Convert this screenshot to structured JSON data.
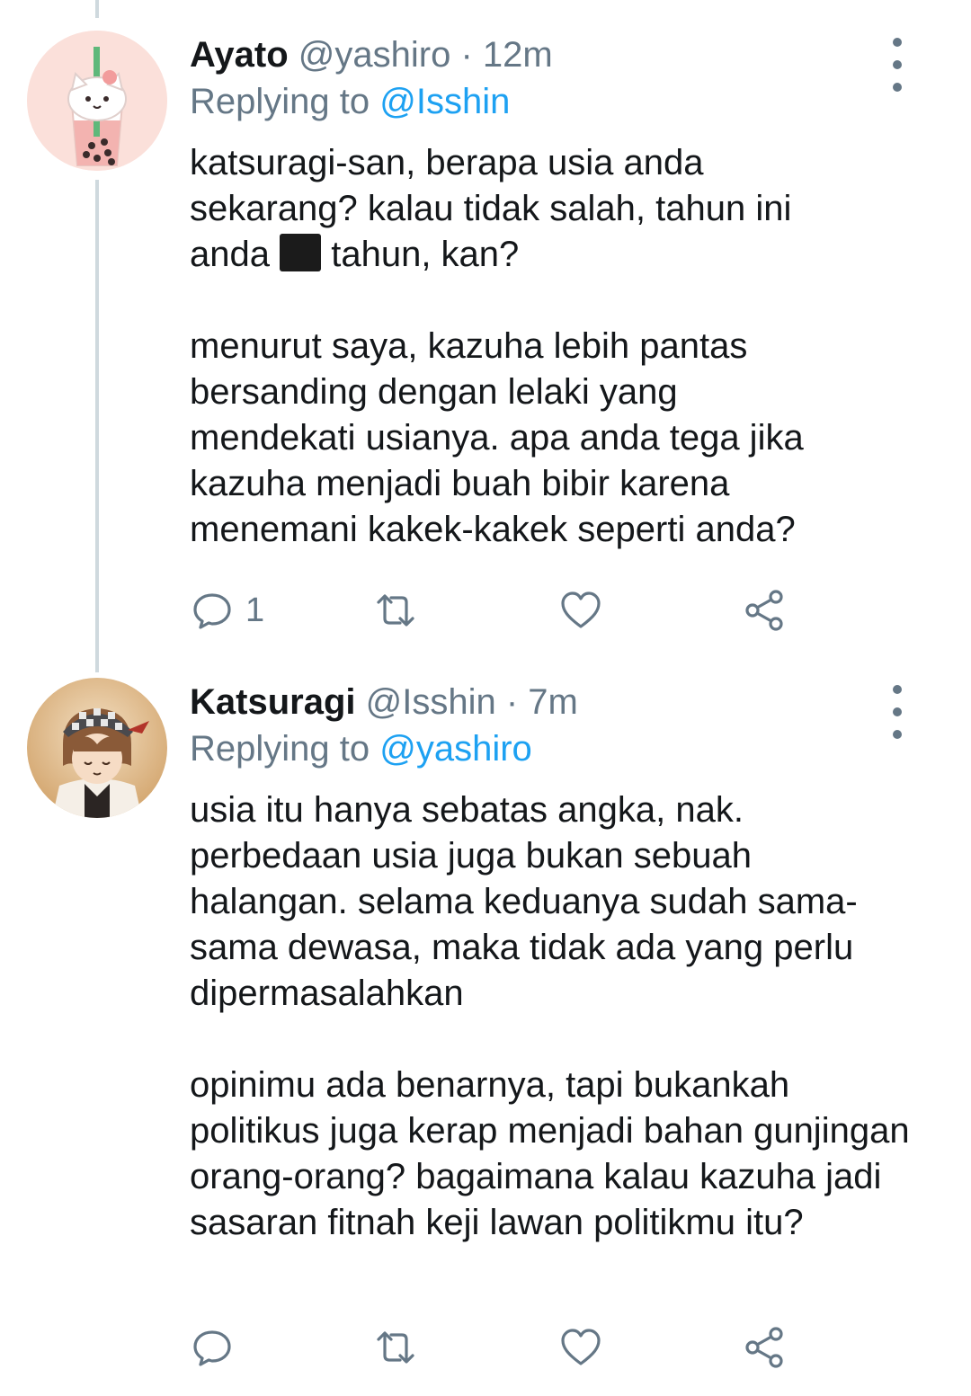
{
  "tweets": [
    {
      "name": "Ayato",
      "handle": "@yashiro",
      "time": "· 12m",
      "replying_prefix": "Replying to",
      "replying_to": "@Isshin",
      "para1_a": "katsuragi-san, berapa usia anda sekarang? kalau tidak salah, tahun ini anda",
      "para1_b": "tahun, kan?",
      "para2": "menurut saya, kazuha lebih pantas bersanding dengan lelaki yang mendekati usianya. apa anda tega jika kazuha menjadi buah bibir karena menemani kakek-kakek seperti anda?",
      "reply_count": "1",
      "avatar_icon": "bubble-tea-cat-avatar"
    },
    {
      "name": "Katsuragi",
      "handle": "@Isshin",
      "time": "· 7m",
      "replying_prefix": "Replying to",
      "replying_to": "@yashiro",
      "para1": "usia itu hanya sebatas angka, nak. perbedaan usia juga bukan sebuah halangan. selama keduanya sudah sama-sama dewasa, maka tidak ada yang perlu dipermasalahkan",
      "para2": "opinimu ada benarnya, tapi bukankah politikus juga kerap menjadi bahan gunjingan orang-orang? bagaimana kalau kazuha jadi sasaran fitnah keji lawan politikmu itu?",
      "reply_count": "",
      "avatar_icon": "anime-character-avatar"
    }
  ],
  "icons": [
    "reply-icon",
    "retweet-icon",
    "like-icon",
    "share-icon",
    "more-options-icon"
  ],
  "colors": {
    "text": "#14171a",
    "muted": "#657786",
    "accent": "#1da1f2",
    "thread_line": "#cfd9de"
  }
}
